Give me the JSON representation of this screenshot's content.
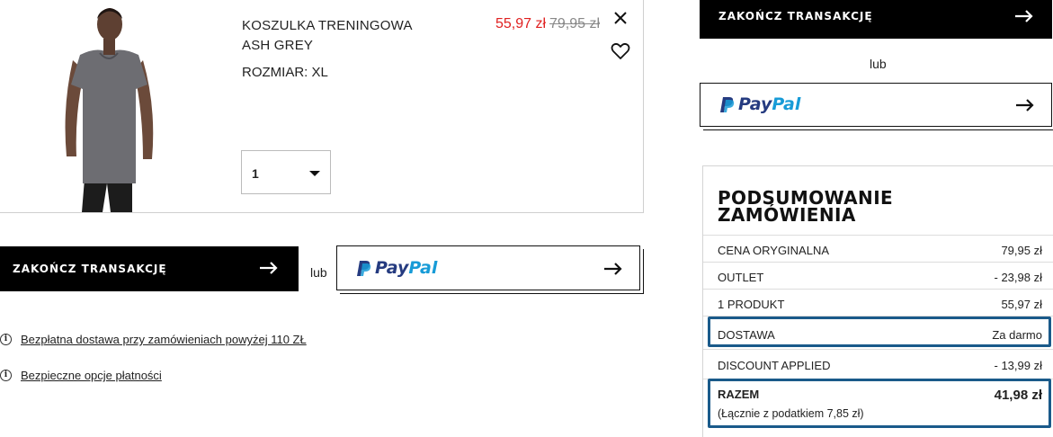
{
  "product": {
    "name_line1": "KOSZULKA TRENINGOWA",
    "name_line2": "ASH GREY",
    "size": "ROZMIAR: XL",
    "price_now": "55,97 zł",
    "price_old": "79,95 zł",
    "quantity": "1"
  },
  "checkout": {
    "button_label": "ZAKOŃCZ TRANSAKCJĘ",
    "or_label": "lub",
    "paypal_pay": "Pay",
    "paypal_pal": "Pal"
  },
  "info": {
    "free_delivery": "Bezpłatna dostawa przy zamówieniach powyżej 110 ZŁ",
    "secure_payment": "Bezpieczne opcje płatności"
  },
  "summary": {
    "title_line1": "PODSUMOWANIE",
    "title_line2": "ZAMÓWIENIA",
    "rows": [
      {
        "label": "CENA ORYGINALNA",
        "value": "79,95 zł"
      },
      {
        "label": "OUTLET",
        "value": "- 23,98 zł"
      },
      {
        "label": "1 PRODUKT",
        "value": "55,97 zł"
      },
      {
        "label": "DOSTAWA",
        "value": "Za darmo"
      },
      {
        "label": "DISCOUNT APPLIED",
        "value": "- 13,99 zł"
      }
    ],
    "total_label": "RAZEM",
    "total_value": "41,98 zł",
    "tax_note": "(Łącznie z podatkiem  7,85 zł)"
  },
  "colors": {
    "sale_price": "#e02020",
    "highlight": "#1a5a8a",
    "paypal_dark": "#253b80",
    "paypal_light": "#179bd7"
  },
  "icons": [
    "close-icon",
    "heart-icon",
    "chevron-down-icon",
    "arrow-right-icon",
    "info-icon",
    "paypal-logo"
  ]
}
